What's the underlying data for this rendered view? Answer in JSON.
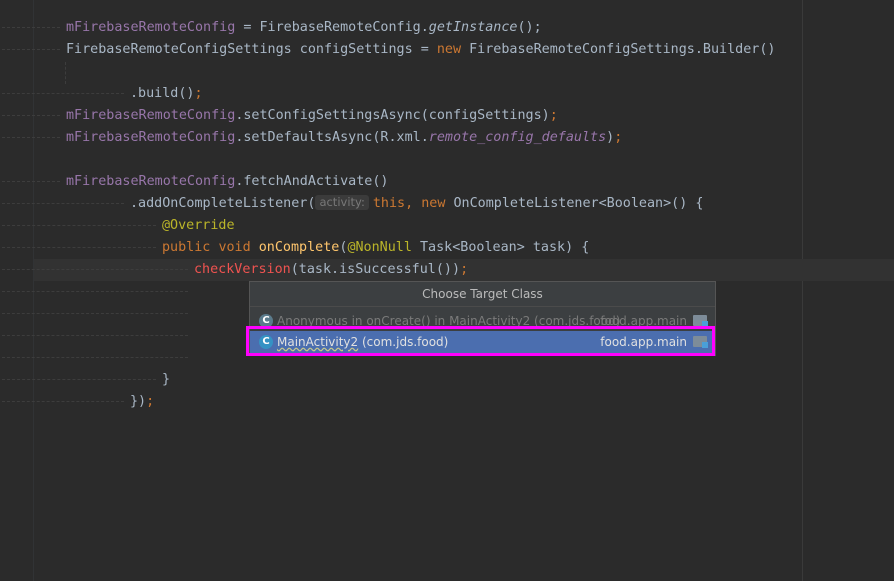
{
  "editor": {
    "lines": {
      "l1": {
        "a": "mFirebaseRemoteConfig",
        "b": " = FirebaseRemoteConfig.",
        "c": "getInstance",
        "d": "();"
      },
      "l2": {
        "a": "FirebaseRemoteConfigSettings configSettings = ",
        "b": "new",
        "c": " FirebaseRemoteConfigSettings.Builder()"
      },
      "l4": {
        "a": ".build()",
        "b": ";"
      },
      "l5": {
        "a": "mFirebaseRemoteConfig",
        "b": ".setConfigSettingsAsync(configSettings)",
        "c": ";"
      },
      "l6": {
        "a": "mFirebaseRemoteConfig",
        "b": ".setDefaultsAsync(R.xml.",
        "c": "remote_config_defaults",
        "d": ")",
        "e": ";"
      },
      "l8": {
        "a": "mFirebaseRemoteConfig",
        "b": ".fetchAndActivate()"
      },
      "l9": {
        "a": ".addOnCompleteListener(",
        "hint": "activity:",
        "b": "this",
        "c": ", ",
        "d": "new",
        "e": " OnCompleteListener<Boolean>() {"
      },
      "l10": {
        "a": "@Override"
      },
      "l11": {
        "a": "public",
        "b": " ",
        "c": "void",
        "d": " ",
        "e": "onComplete",
        "f": "(",
        "g": "@NonNull",
        "h": " Task<Boolean> task) {"
      },
      "l12": {
        "a": "checkVersion",
        "b": "(task.isSuccessful())",
        "c": ";"
      },
      "l16": {
        "a": "}"
      },
      "l17": {
        "a": "})",
        "b": ";"
      }
    }
  },
  "popup": {
    "title": "Choose Target Class",
    "items": [
      {
        "icon_name": "class-icon",
        "icon_glyph": "C",
        "label": "Anonymous in onCreate() in MainActivity2 (com.jds.food)",
        "location": "food.app.main",
        "folder_icon": "module-folder-icon"
      },
      {
        "icon_name": "class-icon",
        "icon_glyph": "C",
        "label_name": "MainActivity2",
        "label_pkg": " (com.jds.food)",
        "location": "food.app.main",
        "folder_icon": "module-folder-icon",
        "selected": true
      }
    ]
  },
  "colors": {
    "background": "#2b2b2b",
    "selection": "#4b6eaf",
    "highlight_box": "#ff00ff",
    "keyword": "#cc7832",
    "field": "#9876aa",
    "method": "#ffc66d",
    "annotation": "#bbb529",
    "error": "#ef5350"
  }
}
